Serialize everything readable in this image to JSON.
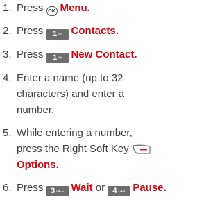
{
  "steps": [
    {
      "number": "1.",
      "pre": "Press",
      "key": "OK",
      "label": "Menu.",
      "label_bold": "Menu"
    },
    {
      "number": "2.",
      "pre": "Press",
      "key": "1",
      "label": "Contacts."
    },
    {
      "number": "3.",
      "pre": "Press",
      "key": "1",
      "label": "New Contact."
    },
    {
      "number": "4.",
      "lines": [
        "Enter a name (up to 32",
        "characters) and enter a",
        "number."
      ]
    },
    {
      "number": "5.",
      "lines": [
        "While entering a number,",
        "press the Right Soft Key"
      ],
      "label": "Options."
    },
    {
      "number": "6.",
      "pre": "Press",
      "key_a": "3",
      "key_a_sub": "DEF",
      "label_a": "Wait",
      "mid": "or",
      "key_b": "4",
      "key_b_sub": "GHI",
      "label_b": "Pause."
    }
  ],
  "colors": {
    "text": "#404040",
    "accent": "#d20a11",
    "key_bg": "#6d6d6d"
  },
  "icons": {
    "ok": "ok-key-icon",
    "numeric": "numeric-key-icon",
    "soft": "right-soft-key-icon"
  }
}
